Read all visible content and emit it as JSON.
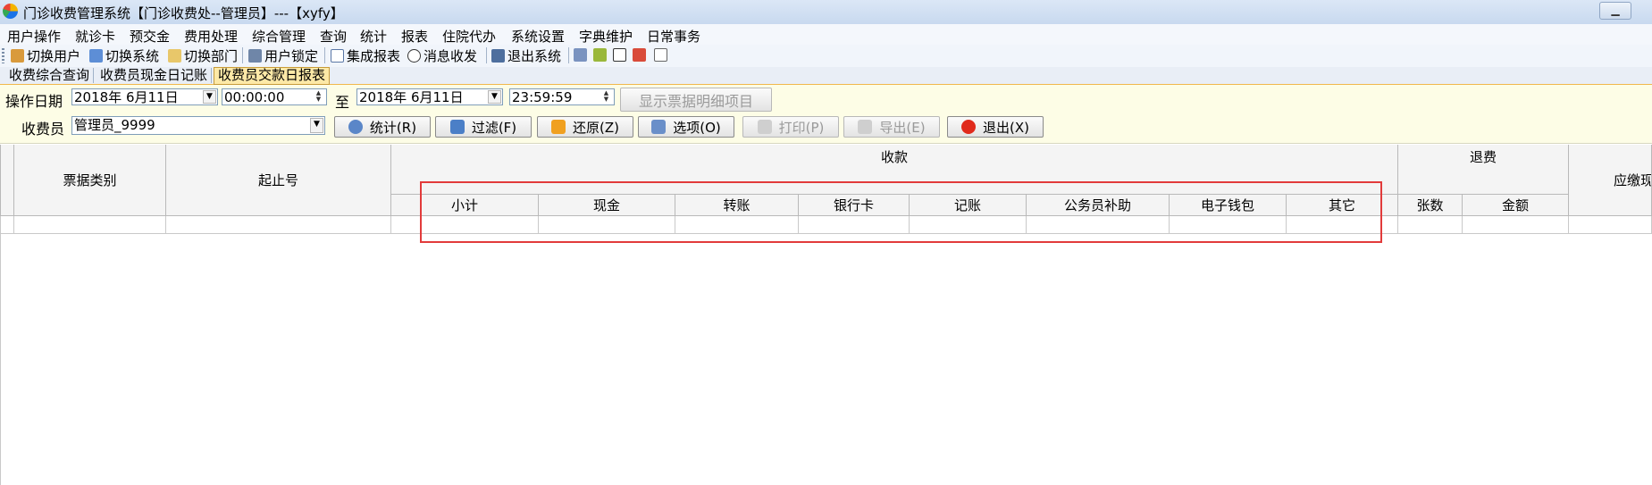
{
  "window": {
    "title": "门诊收费管理系统【门诊收费处--管理员】---【xyfy】"
  },
  "menu": [
    "用户操作",
    "就诊卡",
    "预交金",
    "费用处理",
    "综合管理",
    "查询",
    "统计",
    "报表",
    "住院代办",
    "系统设置",
    "字典维护",
    "日常事务"
  ],
  "toolbar": {
    "switch_user": "切换用户",
    "switch_system": "切换系统",
    "switch_dept": "切换部门",
    "lock_user": "用户锁定",
    "integrated_report": "集成报表",
    "message": "消息收发",
    "exit_system": "退出系统"
  },
  "tabs": [
    "收费综合查询",
    "收费员现金日记账",
    "收费员交款日报表"
  ],
  "filter": {
    "date_label": "操作日期",
    "start_date": "2018年 6月11日",
    "start_time": "00:00:00",
    "to_label": "至",
    "end_date": "2018年 6月11日",
    "end_time": "23:59:59",
    "show_detail_button": "显示票据明细项目",
    "cashier_label": "收费员",
    "cashier_value": "管理员_9999"
  },
  "buttons": {
    "stat": "统计(R)",
    "filter": "过滤(F)",
    "restore": "还原(Z)",
    "options": "选项(O)",
    "print": "打印(P)",
    "export": "导出(E)",
    "exit": "退出(X)"
  },
  "grid": {
    "col_bill_type": "票据类别",
    "col_range": "起止号",
    "group_receipt": "收款",
    "receipt_cols": [
      "小计",
      "现金",
      "转账",
      "银行卡",
      "记账",
      "公务员补助",
      "电子钱包",
      "其它"
    ],
    "group_refund": "退费",
    "refund_cols": [
      "张数",
      "金额"
    ],
    "col_due": "应缴现"
  },
  "colors": {
    "highlight_box": "#e23b3b",
    "panel_bg": "#fdfde6",
    "active_tab": "#fde9a7"
  }
}
